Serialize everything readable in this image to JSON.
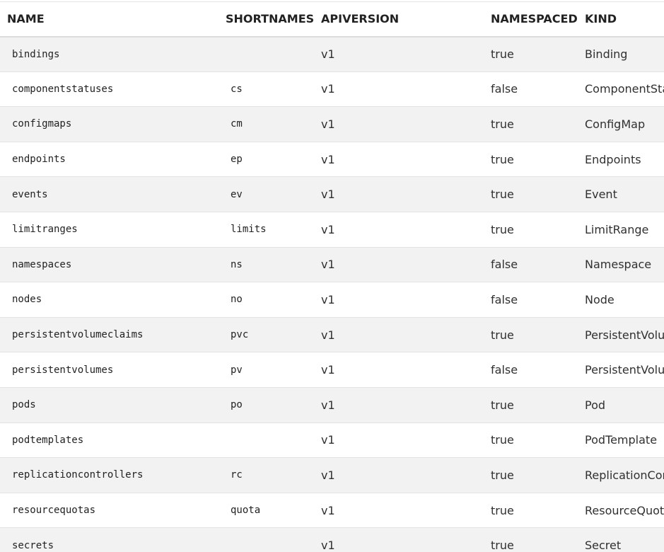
{
  "table": {
    "columns": [
      "NAME",
      "SHORTNAMES",
      "APIVERSION",
      "NAMESPACED",
      "KIND"
    ],
    "rows": [
      {
        "name": "bindings",
        "shortnames": "",
        "apiversion": "v1",
        "namespaced": "true",
        "kind": "Binding"
      },
      {
        "name": "componentstatuses",
        "shortnames": "cs",
        "apiversion": "v1",
        "namespaced": "false",
        "kind": "ComponentStatus"
      },
      {
        "name": "configmaps",
        "shortnames": "cm",
        "apiversion": "v1",
        "namespaced": "true",
        "kind": "ConfigMap"
      },
      {
        "name": "endpoints",
        "shortnames": "ep",
        "apiversion": "v1",
        "namespaced": "true",
        "kind": "Endpoints"
      },
      {
        "name": "events",
        "shortnames": "ev",
        "apiversion": "v1",
        "namespaced": "true",
        "kind": "Event"
      },
      {
        "name": "limitranges",
        "shortnames": "limits",
        "apiversion": "v1",
        "namespaced": "true",
        "kind": "LimitRange"
      },
      {
        "name": "namespaces",
        "shortnames": "ns",
        "apiversion": "v1",
        "namespaced": "false",
        "kind": "Namespace"
      },
      {
        "name": "nodes",
        "shortnames": "no",
        "apiversion": "v1",
        "namespaced": "false",
        "kind": "Node"
      },
      {
        "name": "persistentvolumeclaims",
        "shortnames": "pvc",
        "apiversion": "v1",
        "namespaced": "true",
        "kind": "PersistentVolumeClaim"
      },
      {
        "name": "persistentvolumes",
        "shortnames": "pv",
        "apiversion": "v1",
        "namespaced": "false",
        "kind": "PersistentVolume"
      },
      {
        "name": "pods",
        "shortnames": "po",
        "apiversion": "v1",
        "namespaced": "true",
        "kind": "Pod"
      },
      {
        "name": "podtemplates",
        "shortnames": "",
        "apiversion": "v1",
        "namespaced": "true",
        "kind": "PodTemplate"
      },
      {
        "name": "replicationcontrollers",
        "shortnames": "rc",
        "apiversion": "v1",
        "namespaced": "true",
        "kind": "ReplicationController"
      },
      {
        "name": "resourcequotas",
        "shortnames": "quota",
        "apiversion": "v1",
        "namespaced": "true",
        "kind": "ResourceQuota"
      },
      {
        "name": "secrets",
        "shortnames": "",
        "apiversion": "v1",
        "namespaced": "true",
        "kind": "Secret"
      }
    ]
  }
}
